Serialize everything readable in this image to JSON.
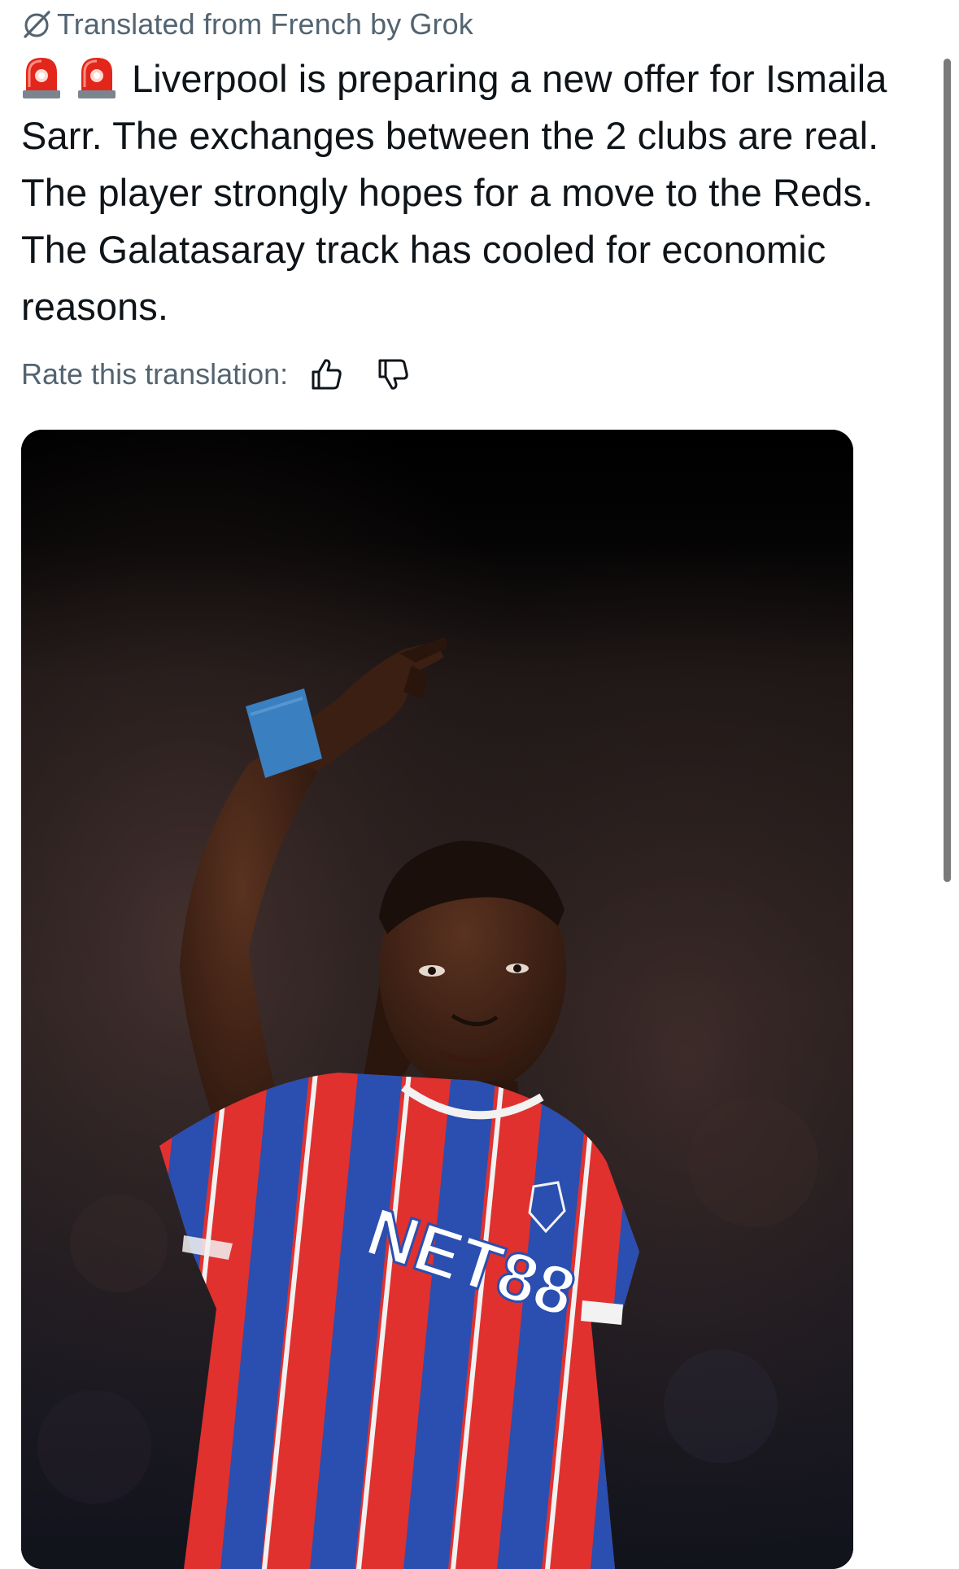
{
  "translation_banner": {
    "label": "Translated from French by Grok",
    "icon": "grok-icon"
  },
  "tweet": {
    "emoji_prefix": [
      "police-light-emoji",
      "police-light-emoji"
    ],
    "text": "Liverpool is preparing a new offer for Ismaila Sarr. The exchanges between the 2 clubs are real. The player strongly hopes for a move to the Reds. The Galatasaray track has cooled for economic reasons."
  },
  "rating": {
    "label": "Rate this translation:",
    "thumbs_up_icon": "thumbs-up-icon",
    "thumbs_down_icon": "thumbs-down-icon"
  },
  "media": {
    "jersey_text": "NET88",
    "colors": {
      "red": "#e0312f",
      "blue": "#2a4fb0",
      "wristband": "#3a7fc0"
    }
  }
}
